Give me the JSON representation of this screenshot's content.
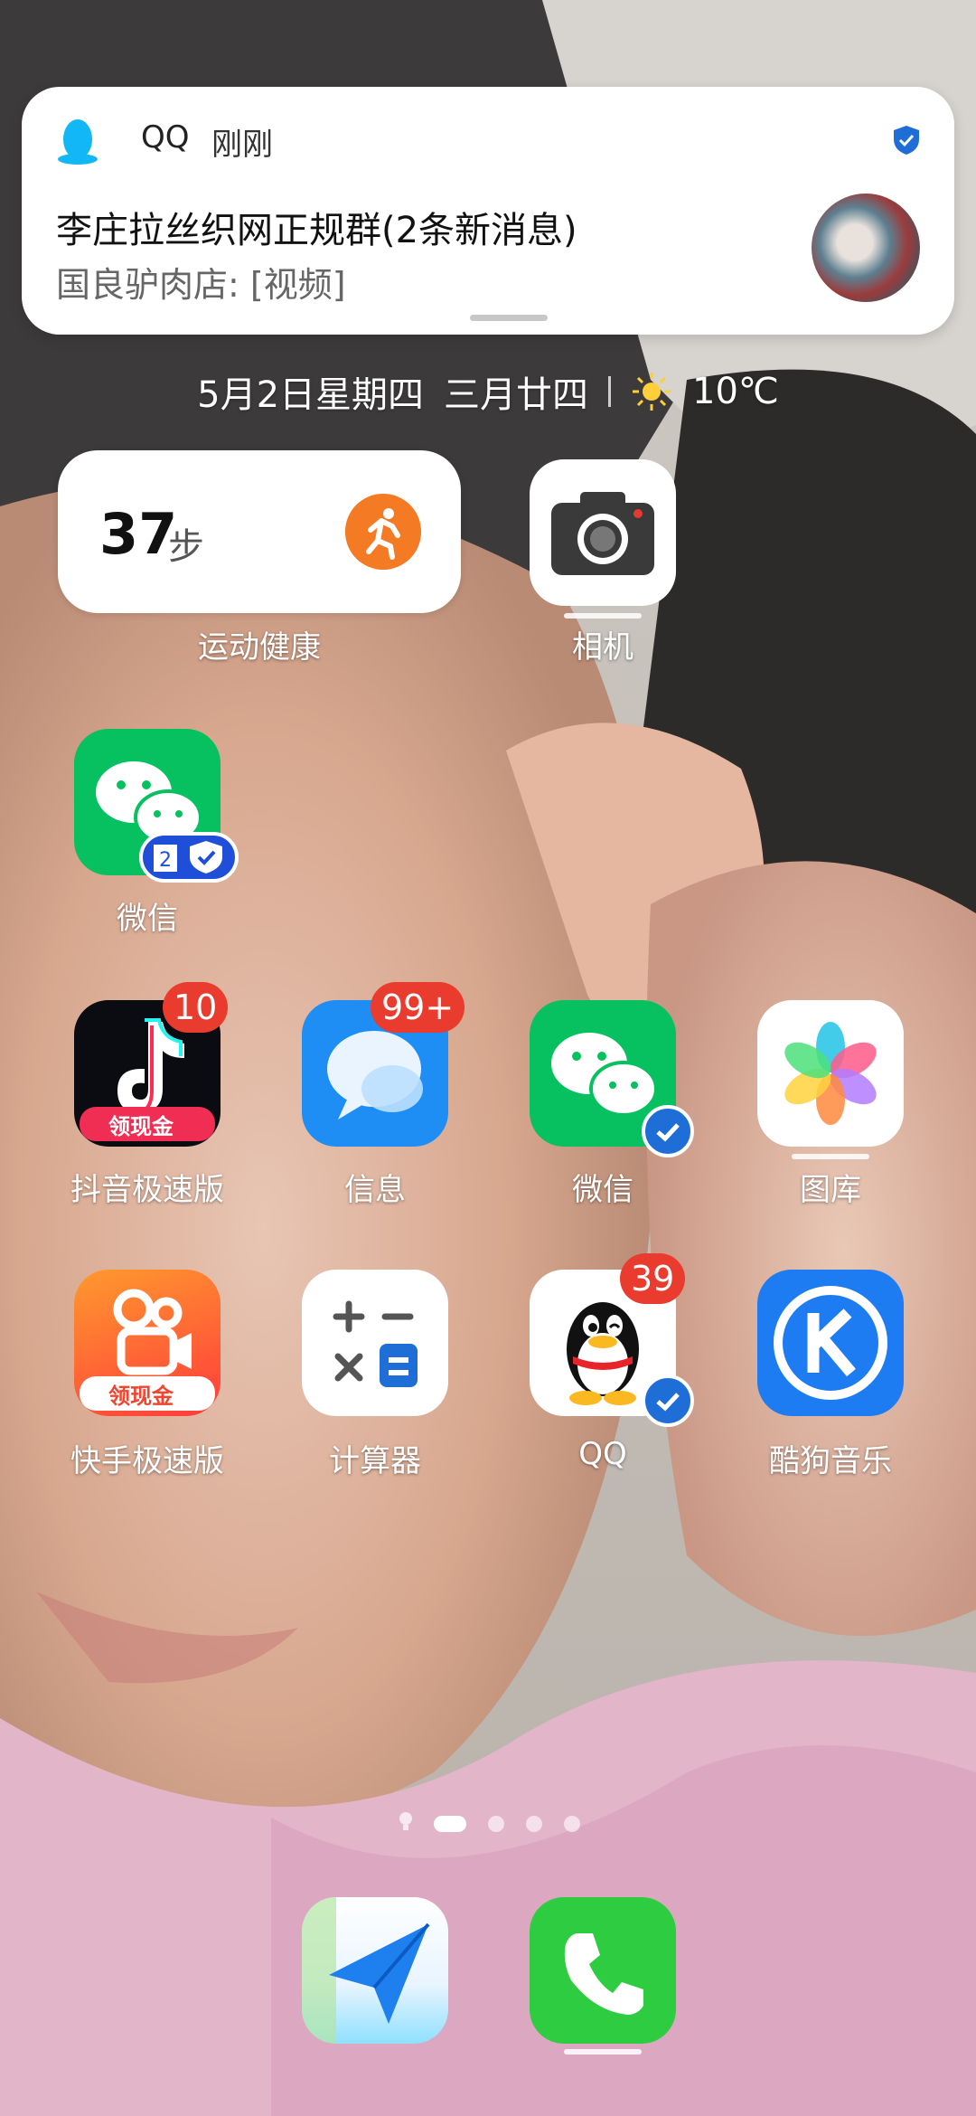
{
  "notification": {
    "app": "QQ",
    "time": "刚刚",
    "title": "李庄拉丝织网正规群(2条新消息)",
    "body": "国良驴肉店: [视频]"
  },
  "status": {
    "date": "5月2日星期四",
    "lunar": "三月廿四",
    "weather_icon": "sun-icon",
    "temp": "10℃"
  },
  "widget": {
    "steps": "37",
    "unit": "步",
    "label": "运动健康"
  },
  "apps": {
    "camera": "相机",
    "wechat_clone": "微信",
    "douyin": "抖音极速版",
    "douyin_tag": "领现金",
    "douyin_badge": "10",
    "messages": "信息",
    "messages_badge": "99+",
    "wechat": "微信",
    "gallery": "图库",
    "kuaishou": "快手极速版",
    "kuaishou_tag": "领现金",
    "calculator": "计算器",
    "qq": "QQ",
    "qq_badge": "39",
    "kugou": "酷狗音乐"
  },
  "pages": {
    "count": 4,
    "current": 1
  },
  "colors": {
    "wechat_green": "#07c160",
    "badge_red": "#ea3b2f",
    "messages_blue": "#1e8ef5",
    "kugou_blue": "#1d7cf2",
    "phone_green": "#2ecc40"
  }
}
